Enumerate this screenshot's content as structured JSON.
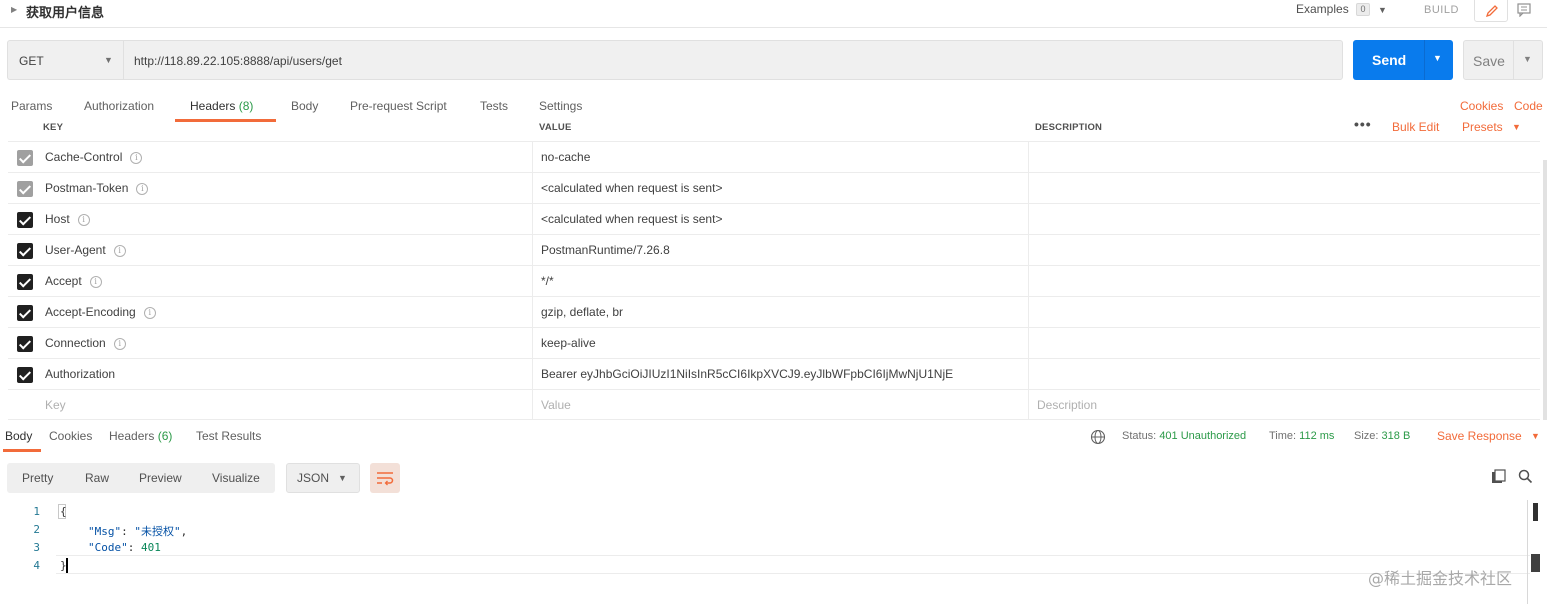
{
  "request_name": "获取用户信息",
  "topbar": {
    "examples_label": "Examples",
    "examples_count": "0",
    "build_label": "BUILD"
  },
  "url_bar": {
    "method": "GET",
    "url": "http://118.89.22.105:8888/api/users/get",
    "send_label": "Send",
    "save_label": "Save"
  },
  "request_tabs": [
    {
      "label": "Params",
      "count": ""
    },
    {
      "label": "Authorization",
      "count": ""
    },
    {
      "label": "Headers",
      "count": "(8)",
      "active": true
    },
    {
      "label": "Body",
      "count": ""
    },
    {
      "label": "Pre-request Script",
      "count": ""
    },
    {
      "label": "Tests",
      "count": ""
    },
    {
      "label": "Settings",
      "count": ""
    }
  ],
  "request_links": {
    "cookies": "Cookies",
    "code": "Code"
  },
  "headers_table": {
    "columns": {
      "key": "KEY",
      "value": "VALUE",
      "description": "DESCRIPTION"
    },
    "more_label": "•••",
    "bulk_edit": "Bulk Edit",
    "presets": "Presets",
    "rows": [
      {
        "key": "Cache-Control",
        "value": "no-cache",
        "checked": "auto",
        "info": "i"
      },
      {
        "key": "Postman-Token",
        "value": "<calculated when request is sent>",
        "checked": "auto",
        "info": "i"
      },
      {
        "key": "Host",
        "value": "<calculated when request is sent>",
        "checked": "on",
        "info": "i"
      },
      {
        "key": "User-Agent",
        "value": "PostmanRuntime/7.26.8",
        "checked": "on",
        "info": "i"
      },
      {
        "key": "Accept",
        "value": "*/*",
        "checked": "on",
        "info": "i"
      },
      {
        "key": "Accept-Encoding",
        "value": "gzip, deflate, br",
        "checked": "on",
        "info": "i"
      },
      {
        "key": "Connection",
        "value": "keep-alive",
        "checked": "on",
        "info": "i"
      },
      {
        "key": "Authorization",
        "value": "Bearer eyJhbGciOiJIUzI1NiIsInR5cCI6IkpXVCJ9.eyJlbWFpbCI6IjMwNjU1NjE",
        "checked": "on",
        "info": ""
      }
    ],
    "placeholders": {
      "key": "Key",
      "value": "Value",
      "description": "Description"
    }
  },
  "response": {
    "tabs": [
      {
        "label": "Body",
        "count": "",
        "active": true
      },
      {
        "label": "Cookies",
        "count": ""
      },
      {
        "label": "Headers",
        "count": "(6)"
      },
      {
        "label": "Test Results",
        "count": ""
      }
    ],
    "status_label": "Status:",
    "status_value": "401 Unauthorized",
    "time_label": "Time:",
    "time_value": "112 ms",
    "size_label": "Size:",
    "size_value": "318 B",
    "save_response": "Save Response",
    "view_modes": [
      "Pretty",
      "Raw",
      "Preview",
      "Visualize"
    ],
    "format": "JSON",
    "code_lines": [
      {
        "n": "1",
        "text": "{"
      },
      {
        "n": "2",
        "key": "\"Msg\"",
        "sep": ": ",
        "str": "\"未授权\"",
        "tail": ","
      },
      {
        "n": "3",
        "key": "\"Code\"",
        "sep": ": ",
        "num": "401"
      },
      {
        "n": "4",
        "text": "}"
      }
    ]
  },
  "watermark": "@稀土掘金技术社区",
  "colors": {
    "accent": "#f26b3a",
    "send": "#097bed",
    "status_ok": "#2b9a48"
  },
  "icons": [
    "collapse-arrow-icon",
    "pencil-icon",
    "comment-icon",
    "info-icon",
    "globe-icon",
    "wrap-lines-icon",
    "copy-icon",
    "search-icon"
  ]
}
